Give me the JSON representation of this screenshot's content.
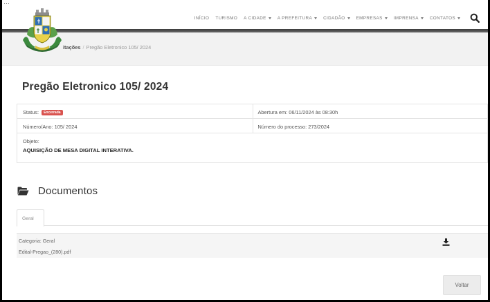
{
  "header": {
    "clipped_text": "…",
    "nav": [
      {
        "label": "Início",
        "caret": false
      },
      {
        "label": "Turismo",
        "caret": false
      },
      {
        "label": "A Cidade",
        "caret": true
      },
      {
        "label": "A Prefeitura",
        "caret": true
      },
      {
        "label": "Cidadão",
        "caret": true
      },
      {
        "label": "Empresas",
        "caret": true
      },
      {
        "label": "Imprensa",
        "caret": true
      },
      {
        "label": "Contatos",
        "caret": true
      }
    ],
    "search_icon": "search-icon"
  },
  "breadcrumb": {
    "parent": "itações",
    "separator": "/",
    "current": "Pregão Eletronico 105/ 2024"
  },
  "page_title": "Pregão Eletronico 105/ 2024",
  "info": {
    "status_label": "Status:",
    "status_badge": "Encerrada",
    "abertura": "Abertura em: 06/11/2024 às 08:30h",
    "numero_ano": "Número/Ano: 105/ 2024",
    "processo": "Número do processo: 273/2024",
    "objeto_label": "Objeto:",
    "objeto_value": "AQUISIÇÃO DE MESA DIGITAL INTERATIVA."
  },
  "documents": {
    "title": "Documentos",
    "icon": "folder-open-icon",
    "tabs": [
      "Geral"
    ],
    "items": [
      {
        "categoria": "Categoria: Geral",
        "file": "Edital-Pregao_(280).pdf",
        "icon": "download-icon"
      }
    ]
  },
  "actions": {
    "back_label": "Voltar"
  },
  "colors": {
    "badge": "#d9534f",
    "band": "#4a4a4a"
  }
}
